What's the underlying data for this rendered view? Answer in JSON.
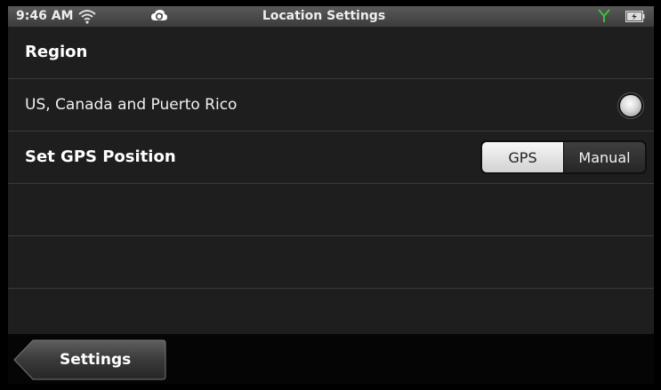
{
  "status_bar": {
    "time": "9:46 AM",
    "title": "Location Settings",
    "icons": [
      "wifi-icon",
      "sync-icon",
      "signal-icon",
      "battery-icon"
    ]
  },
  "region": {
    "header": "Region",
    "option_label": "US, Canada and Puerto Rico",
    "option_selected": true
  },
  "gps": {
    "label": "Set GPS Position",
    "options": [
      "GPS",
      "Manual"
    ],
    "selected": "GPS"
  },
  "bottom_bar": {
    "back_label": "Settings"
  },
  "colors": {
    "background": "#1e1e1e",
    "status_bar": "#4a4a4a",
    "signal_green": "#3fbf3f"
  }
}
